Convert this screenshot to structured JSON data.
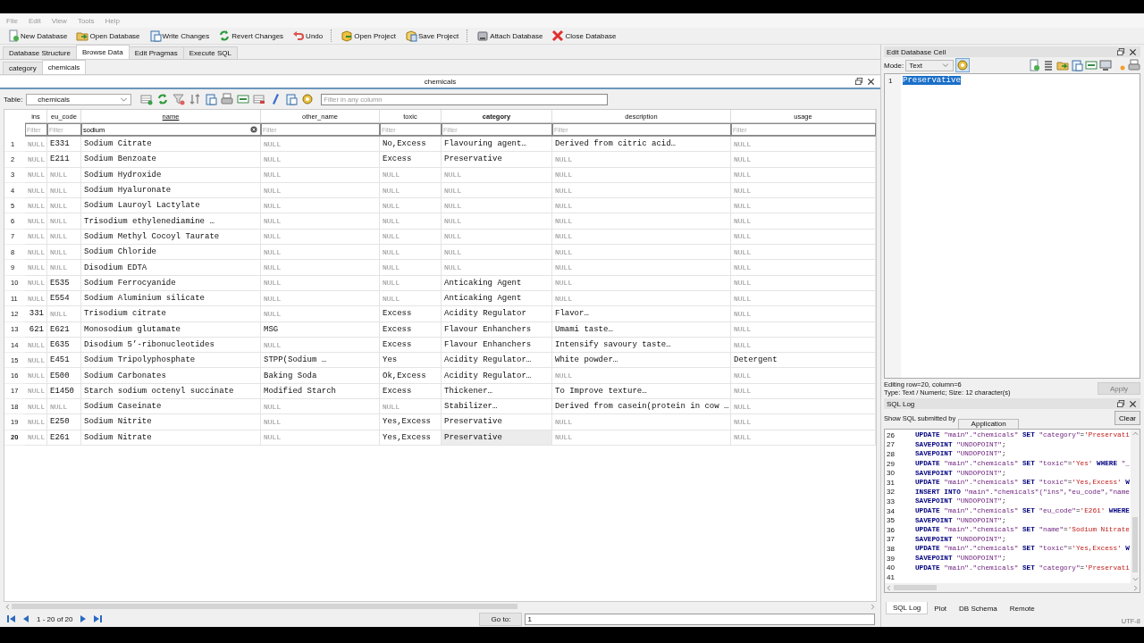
{
  "menu": [
    "File",
    "Edit",
    "View",
    "Tools",
    "Help"
  ],
  "toolbar": [
    [
      {
        "label": "New Database"
      },
      {
        "label": "Open Database"
      },
      {
        "label": "Write Changes"
      },
      {
        "label": "Revert Changes"
      },
      {
        "label": "Undo"
      }
    ],
    [
      {
        "label": "Open Project"
      },
      {
        "label": "Save Project"
      }
    ],
    [
      {
        "label": "Attach Database"
      },
      {
        "label": "Close Database"
      }
    ]
  ],
  "main_tabs": [
    {
      "label": "Database Structure",
      "selected": false
    },
    {
      "label": "Browse Data",
      "selected": true
    },
    {
      "label": "Edit Pragmas",
      "selected": false
    },
    {
      "label": "Execute SQL",
      "selected": false
    }
  ],
  "table_tabs": [
    {
      "label": "category",
      "selected": false
    },
    {
      "label": "chemicals",
      "selected": true
    }
  ],
  "pane_title": "chemicals",
  "table_label": "Table:",
  "table_select": "chemicals",
  "global_filter_placeholder": "Filter in any column",
  "columns": [
    {
      "name": "ins",
      "sorted": false,
      "current": false,
      "filter_placeholder": "Filter"
    },
    {
      "name": "eu_code",
      "sorted": false,
      "current": false,
      "filter_placeholder": "Filter"
    },
    {
      "name": "name",
      "sorted": true,
      "current": false,
      "filter_value": "sodium"
    },
    {
      "name": "other_name",
      "sorted": false,
      "current": false,
      "filter_placeholder": "Filter"
    },
    {
      "name": "toxic",
      "sorted": false,
      "current": false,
      "filter_placeholder": "Filter"
    },
    {
      "name": "category",
      "sorted": false,
      "current": true,
      "filter_placeholder": "Filter"
    },
    {
      "name": "description",
      "sorted": false,
      "current": false,
      "filter_placeholder": "Filter"
    },
    {
      "name": "usage",
      "sorted": false,
      "current": false,
      "filter_placeholder": "Filter"
    }
  ],
  "rows": [
    {
      "number": "1",
      "current": false,
      "cells": [
        {
          "text": "NULL",
          "kind": "null"
        },
        {
          "text": "E331",
          "kind": "text"
        },
        {
          "text": "Sodium Citrate",
          "kind": "text"
        },
        {
          "text": "NULL",
          "kind": "null"
        },
        {
          "text": "No,Excess",
          "kind": "text"
        },
        {
          "text": "Flavouring agent…",
          "kind": "text"
        },
        {
          "text": "Derived from citric acid…",
          "kind": "text"
        },
        {
          "text": "NULL",
          "kind": "null"
        }
      ]
    },
    {
      "number": "2",
      "current": false,
      "cells": [
        {
          "text": "NULL",
          "kind": "null"
        },
        {
          "text": "E211",
          "kind": "text"
        },
        {
          "text": "Sodium Benzoate",
          "kind": "text"
        },
        {
          "text": "NULL",
          "kind": "null"
        },
        {
          "text": "Excess",
          "kind": "text"
        },
        {
          "text": "Preservative",
          "kind": "text"
        },
        {
          "text": "NULL",
          "kind": "null"
        },
        {
          "text": "NULL",
          "kind": "null"
        }
      ]
    },
    {
      "number": "3",
      "current": false,
      "cells": [
        {
          "text": "NULL",
          "kind": "null"
        },
        {
          "text": "NULL",
          "kind": "null"
        },
        {
          "text": "Sodium Hydroxide",
          "kind": "text"
        },
        {
          "text": "NULL",
          "kind": "null"
        },
        {
          "text": "NULL",
          "kind": "null"
        },
        {
          "text": "NULL",
          "kind": "null"
        },
        {
          "text": "NULL",
          "kind": "null"
        },
        {
          "text": "NULL",
          "kind": "null"
        }
      ]
    },
    {
      "number": "4",
      "current": false,
      "cells": [
        {
          "text": "NULL",
          "kind": "null"
        },
        {
          "text": "NULL",
          "kind": "null"
        },
        {
          "text": "Sodium Hyaluronate",
          "kind": "text"
        },
        {
          "text": "NULL",
          "kind": "null"
        },
        {
          "text": "NULL",
          "kind": "null"
        },
        {
          "text": "NULL",
          "kind": "null"
        },
        {
          "text": "NULL",
          "kind": "null"
        },
        {
          "text": "NULL",
          "kind": "null"
        }
      ]
    },
    {
      "number": "5",
      "current": false,
      "cells": [
        {
          "text": "NULL",
          "kind": "null"
        },
        {
          "text": "NULL",
          "kind": "null"
        },
        {
          "text": "Sodium Lauroyl Lactylate",
          "kind": "text"
        },
        {
          "text": "NULL",
          "kind": "null"
        },
        {
          "text": "NULL",
          "kind": "null"
        },
        {
          "text": "NULL",
          "kind": "null"
        },
        {
          "text": "NULL",
          "kind": "null"
        },
        {
          "text": "NULL",
          "kind": "null"
        }
      ]
    },
    {
      "number": "6",
      "current": false,
      "cells": [
        {
          "text": "NULL",
          "kind": "null"
        },
        {
          "text": "NULL",
          "kind": "null"
        },
        {
          "text": "Trisodium ethylenediamine …",
          "kind": "text"
        },
        {
          "text": "NULL",
          "kind": "null"
        },
        {
          "text": "NULL",
          "kind": "null"
        },
        {
          "text": "NULL",
          "kind": "null"
        },
        {
          "text": "NULL",
          "kind": "null"
        },
        {
          "text": "NULL",
          "kind": "null"
        }
      ]
    },
    {
      "number": "7",
      "current": false,
      "cells": [
        {
          "text": "NULL",
          "kind": "null"
        },
        {
          "text": "NULL",
          "kind": "null"
        },
        {
          "text": "Sodium Methyl Cocoyl Taurate",
          "kind": "text"
        },
        {
          "text": "NULL",
          "kind": "null"
        },
        {
          "text": "NULL",
          "kind": "null"
        },
        {
          "text": "NULL",
          "kind": "null"
        },
        {
          "text": "NULL",
          "kind": "null"
        },
        {
          "text": "NULL",
          "kind": "null"
        }
      ]
    },
    {
      "number": "8",
      "current": false,
      "cells": [
        {
          "text": "NULL",
          "kind": "null"
        },
        {
          "text": "NULL",
          "kind": "null"
        },
        {
          "text": "Sodium Chloride",
          "kind": "text"
        },
        {
          "text": "NULL",
          "kind": "null"
        },
        {
          "text": "NULL",
          "kind": "null"
        },
        {
          "text": "NULL",
          "kind": "null"
        },
        {
          "text": "NULL",
          "kind": "null"
        },
        {
          "text": "NULL",
          "kind": "null"
        }
      ]
    },
    {
      "number": "9",
      "current": false,
      "cells": [
        {
          "text": "NULL",
          "kind": "null"
        },
        {
          "text": "NULL",
          "kind": "null"
        },
        {
          "text": "Disodium EDTA",
          "kind": "text"
        },
        {
          "text": "NULL",
          "kind": "null"
        },
        {
          "text": "NULL",
          "kind": "null"
        },
        {
          "text": "NULL",
          "kind": "null"
        },
        {
          "text": "NULL",
          "kind": "null"
        },
        {
          "text": "NULL",
          "kind": "null"
        }
      ]
    },
    {
      "number": "10",
      "current": false,
      "cells": [
        {
          "text": "NULL",
          "kind": "null"
        },
        {
          "text": "E535",
          "kind": "text"
        },
        {
          "text": "Sodium Ferrocyanide",
          "kind": "text"
        },
        {
          "text": "NULL",
          "kind": "null"
        },
        {
          "text": "NULL",
          "kind": "null"
        },
        {
          "text": "Anticaking Agent",
          "kind": "text"
        },
        {
          "text": "NULL",
          "kind": "null"
        },
        {
          "text": "NULL",
          "kind": "null"
        }
      ]
    },
    {
      "number": "11",
      "current": false,
      "cells": [
        {
          "text": "NULL",
          "kind": "null"
        },
        {
          "text": "E554",
          "kind": "text"
        },
        {
          "text": "Sodium Aluminium silicate",
          "kind": "text"
        },
        {
          "text": "NULL",
          "kind": "null"
        },
        {
          "text": "NULL",
          "kind": "null"
        },
        {
          "text": "Anticaking Agent",
          "kind": "text"
        },
        {
          "text": "NULL",
          "kind": "null"
        },
        {
          "text": "NULL",
          "kind": "null"
        }
      ]
    },
    {
      "number": "12",
      "current": false,
      "cells": [
        {
          "text": "331",
          "kind": "number"
        },
        {
          "text": "NULL",
          "kind": "null"
        },
        {
          "text": "Trisodium citrate",
          "kind": "text"
        },
        {
          "text": "NULL",
          "kind": "null"
        },
        {
          "text": "Excess",
          "kind": "text"
        },
        {
          "text": "Acidity Regulator",
          "kind": "text"
        },
        {
          "text": "Flavor…",
          "kind": "text"
        },
        {
          "text": "NULL",
          "kind": "null"
        }
      ]
    },
    {
      "number": "13",
      "current": false,
      "cells": [
        {
          "text": "621",
          "kind": "number"
        },
        {
          "text": "E621",
          "kind": "text"
        },
        {
          "text": "Monosodium glutamate",
          "kind": "text"
        },
        {
          "text": "MSG",
          "kind": "text"
        },
        {
          "text": "Excess",
          "kind": "text"
        },
        {
          "text": "Flavour Enhanchers",
          "kind": "text"
        },
        {
          "text": "Umami taste…",
          "kind": "text"
        },
        {
          "text": "NULL",
          "kind": "null"
        }
      ]
    },
    {
      "number": "14",
      "current": false,
      "cells": [
        {
          "text": "NULL",
          "kind": "null"
        },
        {
          "text": "E635",
          "kind": "text"
        },
        {
          "text": "Disodium 5’-ribonucleotides",
          "kind": "text"
        },
        {
          "text": "NULL",
          "kind": "null"
        },
        {
          "text": "Excess",
          "kind": "text"
        },
        {
          "text": "Flavour Enhanchers",
          "kind": "text"
        },
        {
          "text": "Intensify savoury taste…",
          "kind": "text"
        },
        {
          "text": "NULL",
          "kind": "null"
        }
      ]
    },
    {
      "number": "15",
      "current": false,
      "cells": [
        {
          "text": "NULL",
          "kind": "null"
        },
        {
          "text": "E451",
          "kind": "text"
        },
        {
          "text": "Sodium Tripolyphosphate",
          "kind": "text"
        },
        {
          "text": "STPP(Sodium …",
          "kind": "text"
        },
        {
          "text": "Yes",
          "kind": "text"
        },
        {
          "text": "Acidity Regulator…",
          "kind": "text"
        },
        {
          "text": "White powder…",
          "kind": "text"
        },
        {
          "text": "Detergent",
          "kind": "text"
        }
      ]
    },
    {
      "number": "16",
      "current": false,
      "cells": [
        {
          "text": "NULL",
          "kind": "null"
        },
        {
          "text": "E500",
          "kind": "text"
        },
        {
          "text": "Sodium Carbonates",
          "kind": "text"
        },
        {
          "text": "Baking Soda",
          "kind": "text"
        },
        {
          "text": "Ok,Excess",
          "kind": "text"
        },
        {
          "text": "Acidity Regulator…",
          "kind": "text"
        },
        {
          "text": "NULL",
          "kind": "null"
        },
        {
          "text": "NULL",
          "kind": "null"
        }
      ]
    },
    {
      "number": "17",
      "current": false,
      "cells": [
        {
          "text": "NULL",
          "kind": "null"
        },
        {
          "text": "E1450",
          "kind": "text"
        },
        {
          "text": "Starch sodium octenyl succinate",
          "kind": "text"
        },
        {
          "text": "Modified Starch",
          "kind": "text"
        },
        {
          "text": "Excess",
          "kind": "text"
        },
        {
          "text": "Thickener…",
          "kind": "text"
        },
        {
          "text": "To Improve texture…",
          "kind": "text"
        },
        {
          "text": "NULL",
          "kind": "null"
        }
      ]
    },
    {
      "number": "18",
      "current": false,
      "cells": [
        {
          "text": "NULL",
          "kind": "null"
        },
        {
          "text": "NULL",
          "kind": "null"
        },
        {
          "text": "Sodium Caseinate",
          "kind": "text"
        },
        {
          "text": "NULL",
          "kind": "null"
        },
        {
          "text": "NULL",
          "kind": "null"
        },
        {
          "text": "Stabilizer…",
          "kind": "text"
        },
        {
          "text": "Derived from casein(protein in cow …",
          "kind": "text"
        },
        {
          "text": "NULL",
          "kind": "null"
        }
      ]
    },
    {
      "number": "19",
      "current": false,
      "cells": [
        {
          "text": "NULL",
          "kind": "null"
        },
        {
          "text": "E250",
          "kind": "text"
        },
        {
          "text": "Sodium Nitrite",
          "kind": "text"
        },
        {
          "text": "NULL",
          "kind": "null"
        },
        {
          "text": "Yes,Excess",
          "kind": "text"
        },
        {
          "text": "Preservative",
          "kind": "text"
        },
        {
          "text": "NULL",
          "kind": "null"
        },
        {
          "text": "NULL",
          "kind": "null"
        }
      ]
    },
    {
      "number": "20",
      "current": true,
      "cells": [
        {
          "text": "NULL",
          "kind": "null"
        },
        {
          "text": "E261",
          "kind": "text"
        },
        {
          "text": "Sodium Nitrate",
          "kind": "text"
        },
        {
          "text": "NULL",
          "kind": "null"
        },
        {
          "text": "Yes,Excess",
          "kind": "text"
        },
        {
          "text": "Preservative",
          "kind": "text"
        },
        {
          "text": "NULL",
          "kind": "null"
        },
        {
          "text": "NULL",
          "kind": "null"
        }
      ]
    }
  ],
  "record_count": "1 - 20 of 20",
  "goto_label": "Go to:",
  "goto_value": "1",
  "edit_cell": {
    "title": "Edit Database Cell",
    "mode_label": "Mode:",
    "mode": "Text",
    "line_number": "1",
    "value": "Preservative",
    "status": [
      "Editing row=20, column=6",
      "Type: Text / Numeric; Size: 12 character(s)"
    ],
    "apply": {
      "label": "Apply",
      "disabled": true
    }
  },
  "sql_log": {
    "title": "SQL Log",
    "submitted_label": "Show SQL submitted by",
    "submitted_by": "Application",
    "clear": "Clear",
    "lines": [
      {
        "number": "26",
        "parts": [
          {
            "kind": "keyword",
            "text": "UPDATE "
          },
          {
            "kind": "ident",
            "text": "\"main\".\"chemicals\" "
          },
          {
            "kind": "keyword",
            "text": "SET "
          },
          {
            "kind": "ident",
            "text": "\"category\""
          },
          {
            "kind": "plain",
            "text": "="
          },
          {
            "kind": "string",
            "text": "'Preservati"
          }
        ]
      },
      {
        "number": "27",
        "parts": [
          {
            "kind": "keyword",
            "text": "SAVEPOINT "
          },
          {
            "kind": "ident",
            "text": "\"UNDOPOINT\""
          },
          {
            "kind": "plain",
            "text": ";"
          }
        ]
      },
      {
        "number": "28",
        "parts": [
          {
            "kind": "keyword",
            "text": "SAVEPOINT "
          },
          {
            "kind": "ident",
            "text": "\"UNDOPOINT\""
          },
          {
            "kind": "plain",
            "text": ";"
          }
        ]
      },
      {
        "number": "29",
        "parts": [
          {
            "kind": "keyword",
            "text": "UPDATE "
          },
          {
            "kind": "ident",
            "text": "\"main\".\"chemicals\" "
          },
          {
            "kind": "keyword",
            "text": "SET "
          },
          {
            "kind": "ident",
            "text": "\"toxic\""
          },
          {
            "kind": "plain",
            "text": "="
          },
          {
            "kind": "string",
            "text": "'Yes' "
          },
          {
            "kind": "keyword",
            "text": "WHERE "
          },
          {
            "kind": "ident",
            "text": "\"_"
          }
        ]
      },
      {
        "number": "30",
        "parts": [
          {
            "kind": "keyword",
            "text": "SAVEPOINT "
          },
          {
            "kind": "ident",
            "text": "\"UNDOPOINT\""
          },
          {
            "kind": "plain",
            "text": ";"
          }
        ]
      },
      {
        "number": "31",
        "parts": [
          {
            "kind": "keyword",
            "text": "UPDATE "
          },
          {
            "kind": "ident",
            "text": "\"main\".\"chemicals\" "
          },
          {
            "kind": "keyword",
            "text": "SET "
          },
          {
            "kind": "ident",
            "text": "\"toxic\""
          },
          {
            "kind": "plain",
            "text": "="
          },
          {
            "kind": "string",
            "text": "'Yes,Excess' "
          },
          {
            "kind": "keyword",
            "text": "W"
          }
        ]
      },
      {
        "number": "32",
        "parts": [
          {
            "kind": "keyword",
            "text": "INSERT INTO "
          },
          {
            "kind": "ident",
            "text": "\"main\".\"chemicals\"(\"ins\",\"eu_code\",\"name"
          }
        ]
      },
      {
        "number": "33",
        "parts": [
          {
            "kind": "keyword",
            "text": "SAVEPOINT "
          },
          {
            "kind": "ident",
            "text": "\"UNDOPOINT\""
          },
          {
            "kind": "plain",
            "text": ";"
          }
        ]
      },
      {
        "number": "34",
        "parts": [
          {
            "kind": "keyword",
            "text": "UPDATE "
          },
          {
            "kind": "ident",
            "text": "\"main\".\"chemicals\" "
          },
          {
            "kind": "keyword",
            "text": "SET "
          },
          {
            "kind": "ident",
            "text": "\"eu_code\""
          },
          {
            "kind": "plain",
            "text": "="
          },
          {
            "kind": "string",
            "text": "'E261' "
          },
          {
            "kind": "keyword",
            "text": "WHERE"
          }
        ]
      },
      {
        "number": "35",
        "parts": [
          {
            "kind": "keyword",
            "text": "SAVEPOINT "
          },
          {
            "kind": "ident",
            "text": "\"UNDOPOINT\""
          },
          {
            "kind": "plain",
            "text": ";"
          }
        ]
      },
      {
        "number": "36",
        "parts": [
          {
            "kind": "keyword",
            "text": "UPDATE "
          },
          {
            "kind": "ident",
            "text": "\"main\".\"chemicals\" "
          },
          {
            "kind": "keyword",
            "text": "SET "
          },
          {
            "kind": "ident",
            "text": "\"name\""
          },
          {
            "kind": "plain",
            "text": "="
          },
          {
            "kind": "string",
            "text": "'Sodium Nitrate"
          }
        ]
      },
      {
        "number": "37",
        "parts": [
          {
            "kind": "keyword",
            "text": "SAVEPOINT "
          },
          {
            "kind": "ident",
            "text": "\"UNDOPOINT\""
          },
          {
            "kind": "plain",
            "text": ";"
          }
        ]
      },
      {
        "number": "38",
        "parts": [
          {
            "kind": "keyword",
            "text": "UPDATE "
          },
          {
            "kind": "ident",
            "text": "\"main\".\"chemicals\" "
          },
          {
            "kind": "keyword",
            "text": "SET "
          },
          {
            "kind": "ident",
            "text": "\"toxic\""
          },
          {
            "kind": "plain",
            "text": "="
          },
          {
            "kind": "string",
            "text": "'Yes,Excess' "
          },
          {
            "kind": "keyword",
            "text": "W"
          }
        ]
      },
      {
        "number": "39",
        "parts": [
          {
            "kind": "keyword",
            "text": "SAVEPOINT "
          },
          {
            "kind": "ident",
            "text": "\"UNDOPOINT\""
          },
          {
            "kind": "plain",
            "text": ";"
          }
        ]
      },
      {
        "number": "40",
        "parts": [
          {
            "kind": "keyword",
            "text": "UPDATE "
          },
          {
            "kind": "ident",
            "text": "\"main\".\"chemicals\" "
          },
          {
            "kind": "keyword",
            "text": "SET "
          },
          {
            "kind": "ident",
            "text": "\"category\""
          },
          {
            "kind": "plain",
            "text": "="
          },
          {
            "kind": "string",
            "text": "'Preservati"
          }
        ]
      },
      {
        "number": "41"
      }
    ]
  },
  "bottom_tabs": [
    {
      "label": "SQL Log",
      "selected": true
    },
    {
      "label": "Plot",
      "selected": false
    },
    {
      "label": "DB Schema",
      "selected": false
    },
    {
      "label": "Remote",
      "selected": false
    }
  ],
  "encoding": "UTF-8"
}
